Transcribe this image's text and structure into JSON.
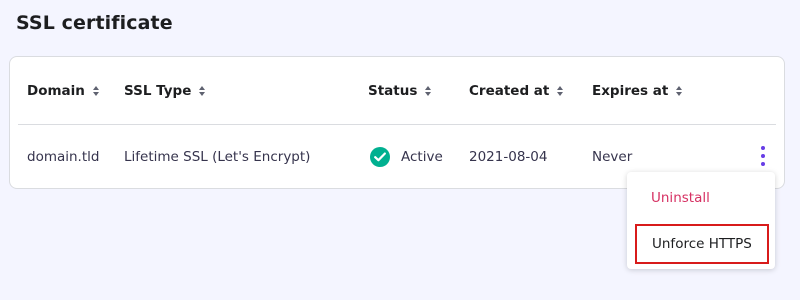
{
  "page": {
    "title": "SSL certificate"
  },
  "table": {
    "columns": [
      "Domain",
      "SSL Type",
      "Status",
      "Created at",
      "Expires at"
    ],
    "rows": [
      {
        "domain": "domain.tld",
        "ssl_type": "Lifetime SSL (Let's Encrypt)",
        "status": "Active",
        "created_at": "2021-08-04",
        "expires_at": "Never"
      }
    ]
  },
  "menu": {
    "uninstall_label": "Uninstall",
    "unforce_https_label": "Unforce HTTPS"
  },
  "icons": {
    "sort": "sort-icon",
    "status": "check-circle-icon",
    "more": "kebab-menu-icon"
  },
  "colors": {
    "accent": "#673de6",
    "success": "#00b090",
    "danger": "#d63163",
    "highlight_border": "#d81b1b"
  }
}
